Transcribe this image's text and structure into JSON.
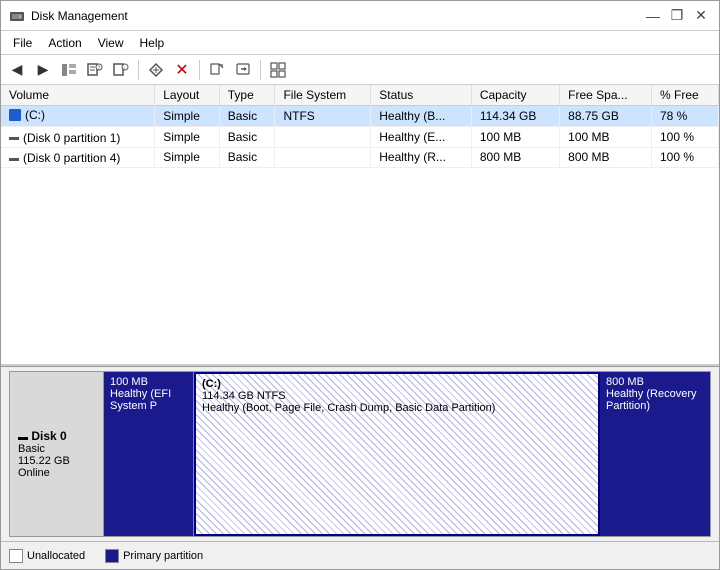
{
  "window": {
    "title": "Disk Management",
    "controls": {
      "minimize": "—",
      "restore": "❐",
      "close": "✕"
    }
  },
  "menu": {
    "items": [
      "File",
      "Action",
      "View",
      "Help"
    ]
  },
  "toolbar": {
    "buttons": [
      {
        "name": "back",
        "icon": "◀"
      },
      {
        "name": "forward",
        "icon": "▶"
      },
      {
        "name": "tree",
        "icon": "▦"
      },
      {
        "name": "help",
        "icon": "?"
      },
      {
        "name": "help2",
        "icon": "?"
      },
      {
        "name": "sep1",
        "type": "separator"
      },
      {
        "name": "arrow",
        "icon": "↗"
      },
      {
        "name": "delete",
        "icon": "✕"
      },
      {
        "name": "sep2",
        "type": "separator"
      },
      {
        "name": "import",
        "icon": "📥"
      },
      {
        "name": "export",
        "icon": "📤"
      },
      {
        "name": "sep3",
        "type": "separator"
      },
      {
        "name": "properties",
        "icon": "⊞"
      }
    ]
  },
  "table": {
    "columns": [
      "Volume",
      "Layout",
      "Type",
      "File System",
      "Status",
      "Capacity",
      "Free Spa...",
      "% Free"
    ],
    "rows": [
      {
        "volume": "(C:)",
        "volume_icon": "blue",
        "layout": "Simple",
        "type": "Basic",
        "filesystem": "NTFS",
        "status": "Healthy (B...",
        "capacity": "114.34 GB",
        "free_space": "88.75 GB",
        "pct_free": "78 %",
        "selected": true
      },
      {
        "volume": "(Disk 0 partition 1)",
        "volume_icon": "gray",
        "layout": "Simple",
        "type": "Basic",
        "filesystem": "",
        "status": "Healthy (E...",
        "capacity": "100 MB",
        "free_space": "100 MB",
        "pct_free": "100 %",
        "selected": false
      },
      {
        "volume": "(Disk 0 partition 4)",
        "volume_icon": "gray",
        "layout": "Simple",
        "type": "Basic",
        "filesystem": "",
        "status": "Healthy (R...",
        "capacity": "800 MB",
        "free_space": "800 MB",
        "pct_free": "100 %",
        "selected": false
      }
    ]
  },
  "disk_view": {
    "disk": {
      "name": "Disk 0",
      "type": "Basic",
      "size": "115.22 GB",
      "status": "Online"
    },
    "partitions": [
      {
        "id": "efi",
        "size": "100 MB",
        "description": "Healthy (EFI System P"
      },
      {
        "id": "c",
        "label": "(C:)",
        "size": "114.34 GB NTFS",
        "description": "Healthy (Boot, Page File, Crash Dump, Basic Data Partition)"
      },
      {
        "id": "recovery",
        "size": "800 MB",
        "description": "Healthy (Recovery Partition)"
      }
    ]
  },
  "status_bar": {
    "legend": [
      {
        "id": "unalloc",
        "label": "Unallocated",
        "color_class": "legend-unalloc"
      },
      {
        "id": "primary",
        "label": "Primary partition",
        "color_class": "legend-primary"
      }
    ]
  }
}
